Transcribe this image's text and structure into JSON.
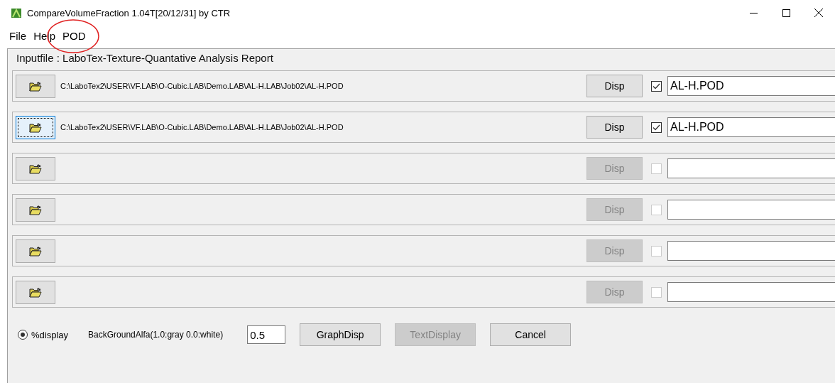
{
  "window": {
    "title": "CompareVolumeFraction 1.04T[20/12/31] by CTR"
  },
  "menu": [
    {
      "label": "File",
      "circled": false
    },
    {
      "label": "Help",
      "circled": false
    },
    {
      "label": "POD",
      "circled": true
    }
  ],
  "panel": {
    "title": "Inputfile : LaboTex-Texture-Quantative Analysis Report"
  },
  "rows": [
    {
      "path": "C:\\LaboTex2\\USER\\VF.LAB\\O-Cubic.LAB\\Demo.LAB\\AL-H.LAB\\Job02\\AL-H.POD",
      "focused": false,
      "disp": "Disp",
      "disabled": false,
      "checked": true,
      "name": "AL-H.POD"
    },
    {
      "path": "C:\\LaboTex2\\USER\\VF.LAB\\O-Cubic.LAB\\Demo.LAB\\AL-H.LAB\\Job02\\AL-H.POD",
      "focused": true,
      "disp": "Disp",
      "disabled": false,
      "checked": true,
      "name": "AL-H.POD"
    },
    {
      "focused": false,
      "disp": "Disp",
      "disabled": true,
      "checked": false
    },
    {
      "focused": false,
      "disp": "Disp",
      "disabled": true,
      "checked": false
    },
    {
      "focused": false,
      "disp": "Disp",
      "disabled": true,
      "checked": false
    },
    {
      "focused": false,
      "disp": "Disp",
      "disabled": true,
      "checked": false
    }
  ],
  "options": {
    "radio": {
      "label": "%display",
      "selected": true
    },
    "alpha_label": "BackGroundAlfa(1.0:gray 0.0:white)",
    "alpha_value": "0.5",
    "buttons": [
      {
        "label": "GraphDisp",
        "disabled": false
      },
      {
        "label": "TextDisplay",
        "disabled": true
      },
      {
        "label": "Cancel",
        "disabled": false
      }
    ]
  }
}
